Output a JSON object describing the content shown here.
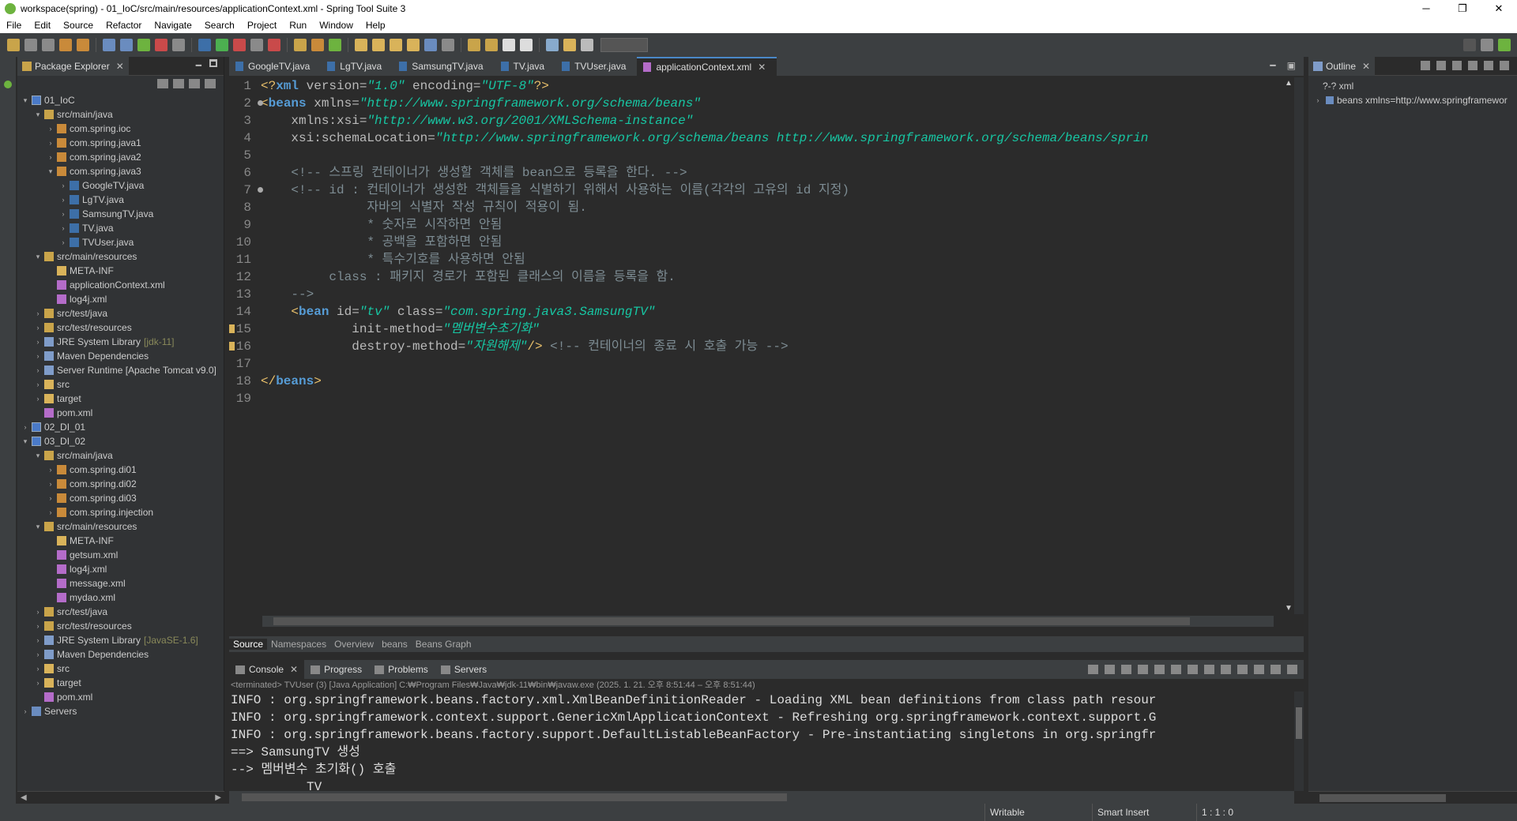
{
  "window": {
    "title": "workspace(spring) - 01_IoC/src/main/resources/applicationContext.xml - Spring Tool Suite 3",
    "minimize": "─",
    "maximize": "❐",
    "close": "✕"
  },
  "menu": [
    "File",
    "Edit",
    "Source",
    "Refactor",
    "Navigate",
    "Search",
    "Project",
    "Run",
    "Window",
    "Help"
  ],
  "package_explorer": {
    "title": "Package Explorer",
    "tree": [
      {
        "indent": 0,
        "arrow": "▾",
        "icon": "proj",
        "label": "01_IoC"
      },
      {
        "indent": 1,
        "arrow": "▾",
        "icon": "src",
        "label": "src/main/java"
      },
      {
        "indent": 2,
        "arrow": "›",
        "icon": "pkg",
        "label": "com.spring.ioc"
      },
      {
        "indent": 2,
        "arrow": "›",
        "icon": "pkg",
        "label": "com.spring.java1"
      },
      {
        "indent": 2,
        "arrow": "›",
        "icon": "pkg",
        "label": "com.spring.java2"
      },
      {
        "indent": 2,
        "arrow": "▾",
        "icon": "pkg",
        "label": "com.spring.java3"
      },
      {
        "indent": 3,
        "arrow": "›",
        "icon": "java",
        "label": "GoogleTV.java"
      },
      {
        "indent": 3,
        "arrow": "›",
        "icon": "java",
        "label": "LgTV.java"
      },
      {
        "indent": 3,
        "arrow": "›",
        "icon": "java",
        "label": "SamsungTV.java"
      },
      {
        "indent": 3,
        "arrow": "›",
        "icon": "java",
        "label": "TV.java"
      },
      {
        "indent": 3,
        "arrow": "›",
        "icon": "java",
        "label": "TVUser.java"
      },
      {
        "indent": 1,
        "arrow": "▾",
        "icon": "src",
        "label": "src/main/resources"
      },
      {
        "indent": 2,
        "arrow": "",
        "icon": "folder",
        "label": "META-INF"
      },
      {
        "indent": 2,
        "arrow": "",
        "icon": "xml",
        "label": "applicationContext.xml"
      },
      {
        "indent": 2,
        "arrow": "",
        "icon": "xml",
        "label": "log4j.xml"
      },
      {
        "indent": 1,
        "arrow": "›",
        "icon": "src",
        "label": "src/test/java"
      },
      {
        "indent": 1,
        "arrow": "›",
        "icon": "src",
        "label": "src/test/resources"
      },
      {
        "indent": 1,
        "arrow": "›",
        "icon": "lib",
        "label": "JRE System Library",
        "deco": "[jdk-11]"
      },
      {
        "indent": 1,
        "arrow": "›",
        "icon": "lib",
        "label": "Maven Dependencies"
      },
      {
        "indent": 1,
        "arrow": "›",
        "icon": "lib",
        "label": "Server Runtime [Apache Tomcat v9.0]"
      },
      {
        "indent": 1,
        "arrow": "›",
        "icon": "folder",
        "label": "src"
      },
      {
        "indent": 1,
        "arrow": "›",
        "icon": "folder",
        "label": "target"
      },
      {
        "indent": 1,
        "arrow": "",
        "icon": "xml",
        "label": "pom.xml"
      },
      {
        "indent": 0,
        "arrow": "›",
        "icon": "proj",
        "label": "02_DI_01"
      },
      {
        "indent": 0,
        "arrow": "▾",
        "icon": "proj",
        "label": "03_DI_02"
      },
      {
        "indent": 1,
        "arrow": "▾",
        "icon": "src",
        "label": "src/main/java"
      },
      {
        "indent": 2,
        "arrow": "›",
        "icon": "pkg",
        "label": "com.spring.di01"
      },
      {
        "indent": 2,
        "arrow": "›",
        "icon": "pkg",
        "label": "com.spring.di02"
      },
      {
        "indent": 2,
        "arrow": "›",
        "icon": "pkg",
        "label": "com.spring.di03"
      },
      {
        "indent": 2,
        "arrow": "›",
        "icon": "pkg",
        "label": "com.spring.injection"
      },
      {
        "indent": 1,
        "arrow": "▾",
        "icon": "src",
        "label": "src/main/resources"
      },
      {
        "indent": 2,
        "arrow": "",
        "icon": "folder",
        "label": "META-INF"
      },
      {
        "indent": 2,
        "arrow": "",
        "icon": "xml",
        "label": "getsum.xml"
      },
      {
        "indent": 2,
        "arrow": "",
        "icon": "xml",
        "label": "log4j.xml"
      },
      {
        "indent": 2,
        "arrow": "",
        "icon": "xml",
        "label": "message.xml"
      },
      {
        "indent": 2,
        "arrow": "",
        "icon": "xml",
        "label": "mydao.xml"
      },
      {
        "indent": 1,
        "arrow": "›",
        "icon": "src",
        "label": "src/test/java"
      },
      {
        "indent": 1,
        "arrow": "›",
        "icon": "src",
        "label": "src/test/resources"
      },
      {
        "indent": 1,
        "arrow": "›",
        "icon": "lib",
        "label": "JRE System Library",
        "deco": "[JavaSE-1.6]"
      },
      {
        "indent": 1,
        "arrow": "›",
        "icon": "lib",
        "label": "Maven Dependencies"
      },
      {
        "indent": 1,
        "arrow": "›",
        "icon": "folder",
        "label": "src"
      },
      {
        "indent": 1,
        "arrow": "›",
        "icon": "folder",
        "label": "target"
      },
      {
        "indent": 1,
        "arrow": "",
        "icon": "xml",
        "label": "pom.xml"
      },
      {
        "indent": 0,
        "arrow": "›",
        "icon": "srv",
        "label": "Servers"
      }
    ]
  },
  "editor": {
    "tabs": [
      {
        "label": "GoogleTV.java",
        "active": false
      },
      {
        "label": "LgTV.java",
        "active": false
      },
      {
        "label": "SamsungTV.java",
        "active": false
      },
      {
        "label": "TV.java",
        "active": false
      },
      {
        "label": "TVUser.java",
        "active": false
      },
      {
        "label": "applicationContext.xml",
        "active": true
      }
    ],
    "lines": [
      {
        "n": "1",
        "mark": "",
        "tokens": [
          [
            "pi",
            "<?"
          ],
          [
            "tag",
            "xml"
          ],
          [
            "attr",
            " version="
          ],
          [
            "val",
            "\"1.0\""
          ],
          [
            "attr",
            " encoding="
          ],
          [
            "val",
            "\"UTF-8\""
          ],
          [
            "pi",
            "?>"
          ]
        ]
      },
      {
        "n": "2",
        "mark": "fold",
        "tokens": [
          [
            "br",
            "<"
          ],
          [
            "tag",
            "beans"
          ],
          [
            "attr",
            " xmlns="
          ],
          [
            "val",
            "\"http://www.springframework.org/schema/beans\""
          ]
        ]
      },
      {
        "n": "3",
        "mark": "",
        "tokens": [
          [
            "attr",
            "    xmlns:xsi="
          ],
          [
            "val",
            "\"http://www.w3.org/2001/XMLSchema-instance\""
          ]
        ]
      },
      {
        "n": "4",
        "mark": "",
        "tokens": [
          [
            "attr",
            "    xsi:schemaLocation="
          ],
          [
            "val",
            "\"http://www.springframework.org/schema/beans http://www.springframework.org/schema/beans/sprin"
          ]
        ]
      },
      {
        "n": "5",
        "mark": "",
        "tokens": []
      },
      {
        "n": "6",
        "mark": "",
        "tokens": [
          [
            "cm",
            "    <!-- 스프링 컨테이너가 생성할 객체를 bean으로 등록을 한다. -->"
          ]
        ]
      },
      {
        "n": "7",
        "mark": "fold",
        "tokens": [
          [
            "cm",
            "    <!-- id : 컨테이너가 생성한 객체들을 식별하기 위해서 사용하는 이름(각각의 고유의 id 지정)"
          ]
        ]
      },
      {
        "n": "8",
        "mark": "",
        "tokens": [
          [
            "cm",
            "              자바의 식별자 작성 규칙이 적용이 됨."
          ]
        ]
      },
      {
        "n": "9",
        "mark": "",
        "tokens": [
          [
            "cm",
            "              * 숫자로 시작하면 안됨"
          ]
        ]
      },
      {
        "n": "10",
        "mark": "",
        "tokens": [
          [
            "cm",
            "              * 공백을 포함하면 안됨"
          ]
        ]
      },
      {
        "n": "11",
        "mark": "",
        "tokens": [
          [
            "cm",
            "              * 특수기호를 사용하면 안됨"
          ]
        ]
      },
      {
        "n": "12",
        "mark": "",
        "tokens": [
          [
            "cm",
            "         class : 패키지 경로가 포함된 클래스의 이름을 등록을 함."
          ]
        ]
      },
      {
        "n": "13",
        "mark": "",
        "tokens": [
          [
            "cm",
            "    -->"
          ]
        ]
      },
      {
        "n": "14",
        "mark": "",
        "tokens": [
          [
            "br",
            "    <"
          ],
          [
            "tag",
            "bean"
          ],
          [
            "attr",
            " id="
          ],
          [
            "val",
            "\"tv\""
          ],
          [
            "attr",
            " class="
          ],
          [
            "val",
            "\"com.spring.java3.SamsungTV\""
          ]
        ]
      },
      {
        "n": "15",
        "mark": "warn",
        "tokens": [
          [
            "attr",
            "            init-method="
          ],
          [
            "val",
            "\"멤버변수초기화\""
          ]
        ]
      },
      {
        "n": "16",
        "mark": "warn",
        "tokens": [
          [
            "attr",
            "            destroy-method="
          ],
          [
            "val",
            "\"자원해제\""
          ],
          [
            "br",
            "/>"
          ],
          [
            "cm",
            " <!-- 컨테이너의 종료 시 호출 가능 -->"
          ]
        ]
      },
      {
        "n": "17",
        "mark": "",
        "tokens": []
      },
      {
        "n": "18",
        "mark": "",
        "tokens": [
          [
            "br",
            "</"
          ],
          [
            "tag",
            "beans"
          ],
          [
            "br",
            ">"
          ]
        ]
      },
      {
        "n": "19",
        "mark": "",
        "tokens": []
      }
    ],
    "bottom_tabs": [
      {
        "label": "Source",
        "active": true
      },
      {
        "label": "Namespaces",
        "active": false
      },
      {
        "label": "Overview",
        "active": false
      },
      {
        "label": "beans",
        "active": false
      },
      {
        "label": "Beans Graph",
        "active": false
      }
    ]
  },
  "console": {
    "tabs": [
      {
        "label": "Console",
        "active": true,
        "close": true
      },
      {
        "label": "Progress",
        "active": false
      },
      {
        "label": "Problems",
        "active": false
      },
      {
        "label": "Servers",
        "active": false
      }
    ],
    "terminated": "<terminated> TVUser (3) [Java Application] C:₩Program Files₩Java₩jdk-11₩bin₩javaw.exe  (2025. 1. 21. 오후 8:51:44 – 오후 8:51:44)",
    "lines": [
      "INFO : org.springframework.beans.factory.xml.XmlBeanDefinitionReader - Loading XML bean definitions from class path resour",
      "INFO : org.springframework.context.support.GenericXmlApplicationContext - Refreshing org.springframework.context.support.G",
      "INFO : org.springframework.beans.factory.support.DefaultListableBeanFactory - Pre-instantiating singletons in org.springfr",
      "==> SamsungTV 생성",
      "--> 멤버변수 초기화() 호출",
      "          TV                                   "
    ]
  },
  "outline": {
    "title": "Outline",
    "nodes": [
      {
        "arrow": "",
        "label": "?-? xml"
      },
      {
        "arrow": "›",
        "label": "beans xmlns=http://www.springframewor"
      }
    ]
  },
  "status": {
    "writable": "Writable",
    "insert_mode": "Smart Insert",
    "position": "1 : 1 : 0"
  },
  "colors": {
    "editor_bg": "#2b2b2b",
    "panel_bg": "#313335",
    "toolbar_bg": "#3c3f41",
    "xml_value": "#17c6a3",
    "xml_tag": "#569cd6",
    "comment": "#7d8c93"
  }
}
